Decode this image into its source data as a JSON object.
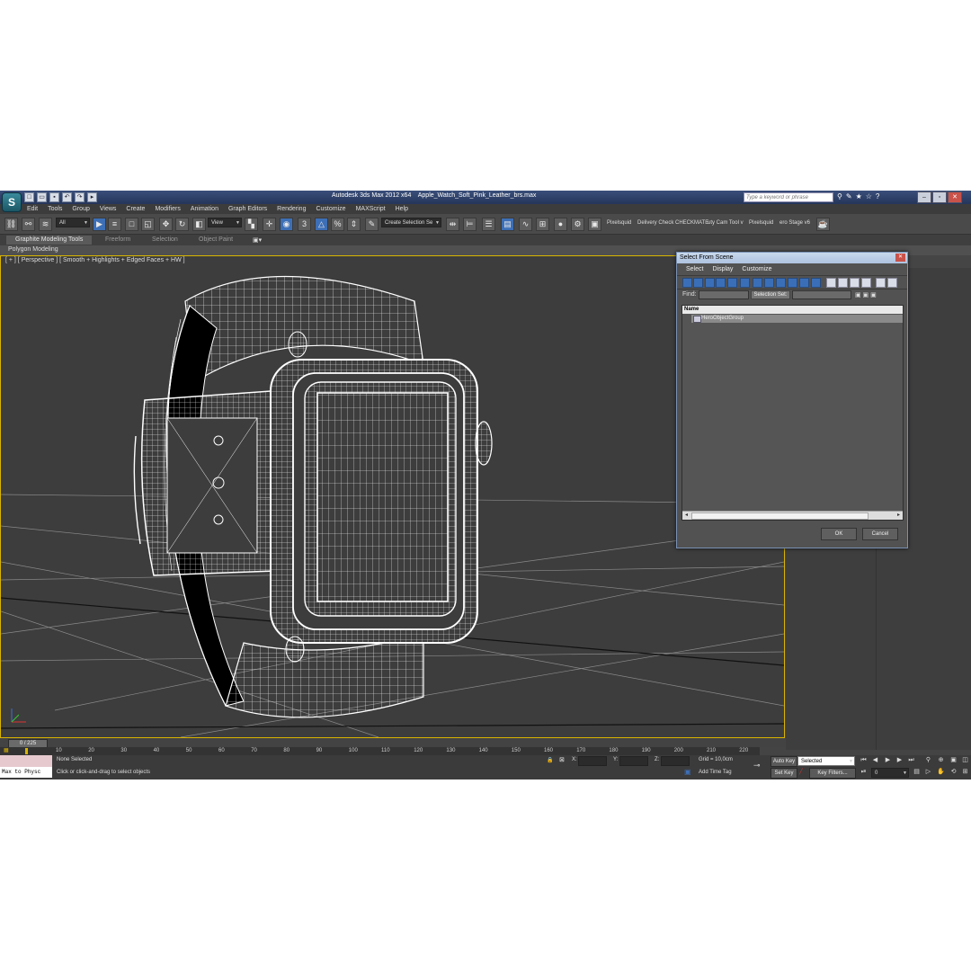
{
  "app": {
    "logo": "S",
    "title_product": "Autodesk 3ds Max  2012 x64",
    "title_file": "Apple_Watch_Soft_Pink_Leather_brs.max",
    "search_placeholder": "Type a keyword or phrase"
  },
  "menu": [
    "Edit",
    "Tools",
    "Group",
    "Views",
    "Create",
    "Modifiers",
    "Animation",
    "Graph Editors",
    "Rendering",
    "Customize",
    "MAXScript",
    "Help"
  ],
  "toolbar": {
    "filter_value": "All",
    "ref_coord_value": "View",
    "snap_value": "3",
    "selection_set_value": "Create Selection Se",
    "plugins": [
      "Pixelsquid",
      "Delivery Check",
      "CHECKMATE",
      "uty Cam Tool v",
      "Pixelsquid",
      "ero Stage v6"
    ]
  },
  "ribbon": {
    "tabs": [
      "Graphite Modeling Tools",
      "Freeform",
      "Selection",
      "Object Paint"
    ],
    "sub": "Polygon Modeling"
  },
  "viewport": {
    "label": "[ + ] [ Perspective ] [ Smooth + Highlights + Edged Faces + HW ]"
  },
  "dialog": {
    "title": "Select From Scene",
    "menu": [
      "Select",
      "Display",
      "Customize"
    ],
    "find_label": "Find:",
    "selection_set_label": "Selection Set:",
    "column_header": "Name",
    "rows": [
      "HeroObjectGroup"
    ],
    "ok_label": "OK",
    "cancel_label": "Cancel"
  },
  "timeline": {
    "frame_display": "0 / 225",
    "ticks": [
      "10",
      "20",
      "30",
      "40",
      "50",
      "60",
      "70",
      "80",
      "90",
      "100",
      "110",
      "120",
      "130",
      "140",
      "150",
      "160",
      "170",
      "180",
      "190",
      "200",
      "210",
      "220"
    ]
  },
  "status": {
    "listener_text": "Max to Physc",
    "selection_text": "None Selected",
    "prompt_text": "Click or click-and-drag to select objects",
    "x_label": "X:",
    "y_label": "Y:",
    "z_label": "Z:",
    "grid_text": "Grid = 10,0cm",
    "add_time_tag": "Add Time Tag",
    "auto_key": "Auto Key",
    "selected_value": "Selected",
    "set_key": "Set Key",
    "key_filters": "Key Filters...",
    "frame_value": "0"
  },
  "colors": {
    "viewport_border": "#d9b400",
    "title_bar": "#25355a",
    "selection_blue": "#3d6fb6"
  }
}
